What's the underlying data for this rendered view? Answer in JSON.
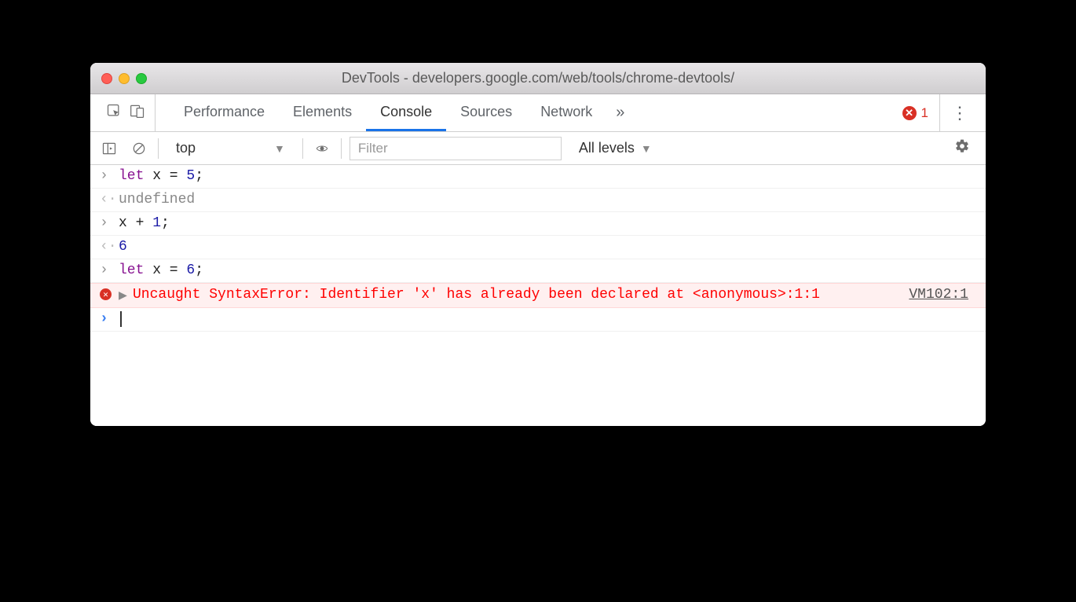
{
  "window": {
    "title": "DevTools - developers.google.com/web/tools/chrome-devtools/"
  },
  "tabs": {
    "items": [
      "Performance",
      "Elements",
      "Console",
      "Sources",
      "Network"
    ],
    "active": "Console",
    "overflow": "»"
  },
  "errors": {
    "count": "1"
  },
  "subtoolbar": {
    "context": "top",
    "filter_placeholder": "Filter",
    "levels_label": "All levels"
  },
  "console": {
    "lines": [
      {
        "type": "input",
        "kw": "let",
        "rest": " x = ",
        "num": "5",
        "tail": ";"
      },
      {
        "type": "output",
        "undef": "undefined"
      },
      {
        "type": "input",
        "txt": "x + ",
        "num": "1",
        "tail": ";"
      },
      {
        "type": "output",
        "num": "6"
      },
      {
        "type": "input",
        "kw": "let",
        "rest": " x = ",
        "num": "6",
        "tail": ";"
      }
    ],
    "error": {
      "msg1": "Uncaught SyntaxError: Identifier 'x' has already been declared",
      "msg2": "    at <anonymous>:1:1",
      "link": "VM102:1"
    }
  },
  "icons": {
    "close_x": "✕",
    "kebab": "⋮",
    "caret_down": "▼",
    "expand_right": "▶"
  }
}
